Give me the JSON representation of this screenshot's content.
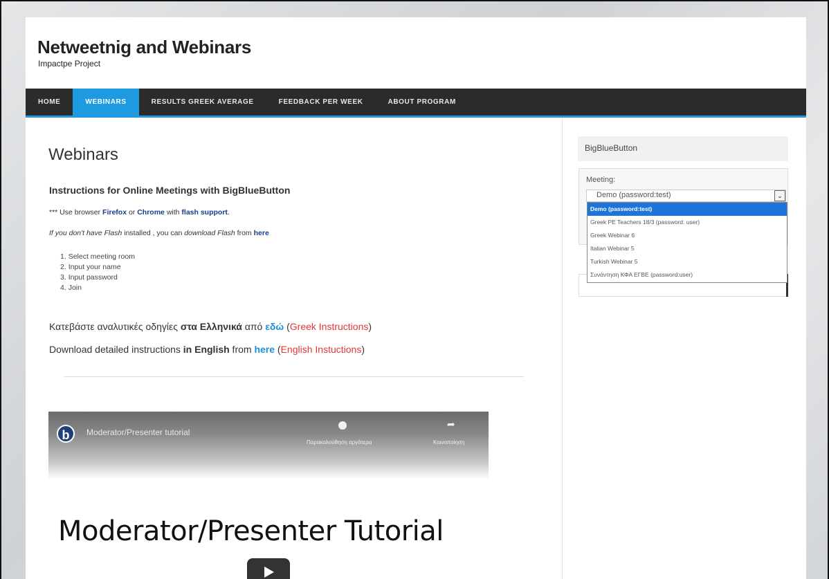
{
  "site": {
    "title": "Netweetnig and Webinars",
    "subtitle": "Impactpe Project"
  },
  "nav": {
    "items": [
      {
        "label": "HOME"
      },
      {
        "label": "WEBINARS"
      },
      {
        "label": "RESULTS GREEK AVERAGE"
      },
      {
        "label": "FEEDBACK PER WEEK"
      },
      {
        "label": "ABOUT PROGRAM"
      }
    ],
    "active_index": 1,
    "accent_color": "#1e9be0"
  },
  "main": {
    "page_title": "Webinars",
    "instructions_title": "Instructions for Online Meetings with BigBlueButton",
    "browser_note": {
      "prefix": "*** Use browser ",
      "firefox": "Firefox",
      "or": " or ",
      "chrome": "Chrome",
      "with": " with ",
      "flash": "flash support",
      "suffix": "."
    },
    "flash_note": {
      "part1": "If you don't have Flash",
      "part2": " installed , you can ",
      "part3": "download Flash",
      "part4": " from ",
      "link": "here"
    },
    "steps": [
      "Select meeting room",
      "Input your name",
      "Input password",
      "Join"
    ],
    "greek_line": {
      "text": "Κατεβάστε αναλυτικές οδηγίες ",
      "bold": "στα Ελληνικά",
      "mid": " από ",
      "link": "εδώ",
      "open": " (",
      "red": "Greek Instructions",
      "close": ")"
    },
    "english_line": {
      "text": "Download detailed instructions ",
      "bold": "in English",
      "mid": " from ",
      "link": "here",
      "open": " (",
      "red": "English Instuctions",
      "close": ")"
    },
    "video": {
      "title": "Moderator/Presenter tutorial",
      "watch_later": "Παρακολούθηση αργότερα",
      "share": "Κοινοποίηση",
      "big_text": "Moderator/Presenter Tutorial",
      "icon_clock": "clock-icon",
      "icon_share": "share-icon",
      "icon_play": "play-icon"
    }
  },
  "sidebar": {
    "widget_title": "BigBlueButton",
    "meeting_label": "Meeting:",
    "selected": "Demo (password:test)",
    "options": [
      "Demo (password:test)",
      "Greek PE Teachers 18/3 (password: user)",
      "Greek Webinar 6",
      "Italian Webinar 5",
      "Turkish Webinar 5",
      "Συνάντηση ΚΦΑ ΕΓΒΕ (password:user)"
    ],
    "selected_index": 0
  }
}
